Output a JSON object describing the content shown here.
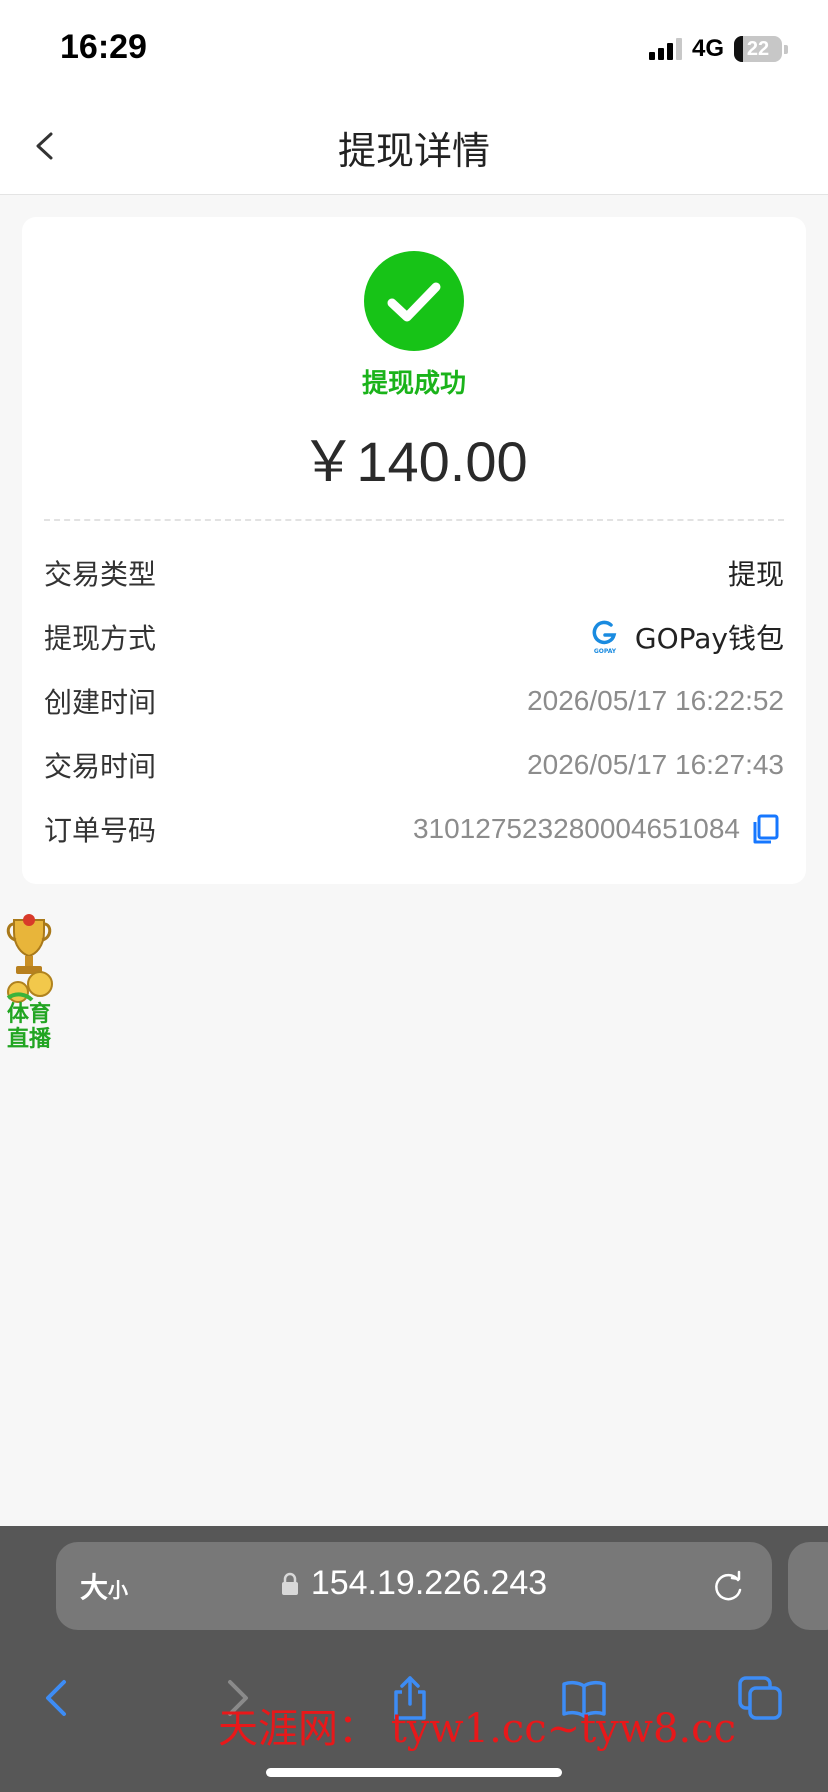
{
  "status_bar": {
    "time": "16:29",
    "network": "4G",
    "battery": "22"
  },
  "nav": {
    "title": "提现详情",
    "back_icon": "chevron-left-icon"
  },
  "card": {
    "status_icon": "check-circle-icon",
    "status_color": "#17c317",
    "status_text": "提现成功",
    "amount": "￥140.00",
    "rows": [
      {
        "label": "交易类型",
        "value": "提现"
      },
      {
        "label": "提现方式",
        "value": "GOPay钱包",
        "icon": "gopay-logo-icon",
        "logo_text": "GOPAY"
      },
      {
        "label": "创建时间",
        "value": "2026/05/17 16:22:52"
      },
      {
        "label": "交易时间",
        "value": "2026/05/17 16:27:43"
      },
      {
        "label": "订单号码",
        "value": "310127523280004651084",
        "icon": "copy-icon"
      }
    ]
  },
  "float_ad": {
    "text": "体育直播",
    "icon": "trophy-icon"
  },
  "browser": {
    "text_size_label": "大",
    "text_size_small": "小",
    "url": "154.19.226.243",
    "icons": [
      "lock-icon",
      "reload-icon",
      "back-icon",
      "forward-icon",
      "share-icon",
      "bookmarks-icon",
      "tabs-icon"
    ]
  },
  "watermark": "天涯网： tyw1.cc~tyw8.cc"
}
